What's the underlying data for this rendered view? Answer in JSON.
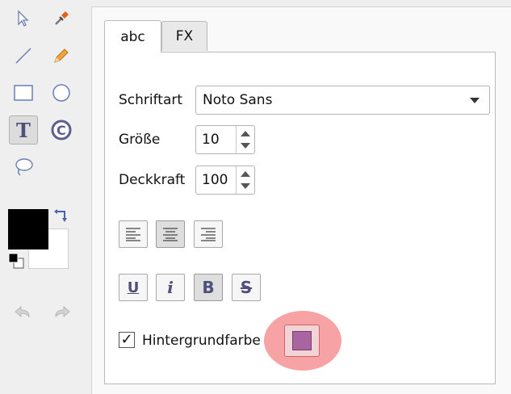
{
  "tabs": [
    {
      "label": "abc",
      "active": true
    },
    {
      "label": "FX",
      "active": false
    }
  ],
  "font": {
    "label": "Schriftart",
    "value": "Noto Sans"
  },
  "size": {
    "label": "Größe",
    "value": "10"
  },
  "opacity": {
    "label": "Deckkraft",
    "value": "100"
  },
  "style_buttons": {
    "underline": "U",
    "italic": "i",
    "bold": "B",
    "strikethrough": "S"
  },
  "background": {
    "checked": true,
    "check_mark": "✓",
    "label": "Hintergrundfarbe",
    "swatch_color": "#a965a1"
  },
  "colors": {
    "foreground": "#000000",
    "background": "#ffffff",
    "highlight": "#f7a3a6"
  },
  "tools": [
    "select-arrow-icon",
    "eyedropper-icon",
    "line-icon",
    "pencil-icon",
    "rectangle-icon",
    "ellipse-icon",
    "text-icon",
    "copyright-stamp-icon",
    "lasso-icon",
    "undo-icon",
    "redo-icon"
  ]
}
